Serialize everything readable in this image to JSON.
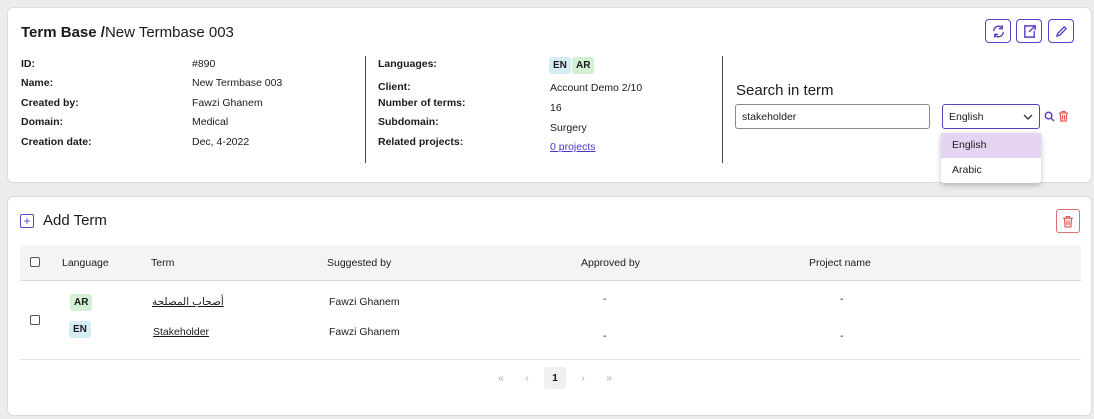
{
  "header": {
    "title_prefix": "Term Base /",
    "title_name": "New Termbase 003"
  },
  "details": {
    "id_label": "ID:",
    "id_value": "#890",
    "name_label": "Name:",
    "name_value": "New Termbase 003",
    "created_by_label": "Created by:",
    "created_by_value": "Fawzi Ghanem",
    "domain_label": "Domain:",
    "domain_value": "Medical",
    "creation_date_label": "Creation date:",
    "creation_date_value": "Dec, 4-2022",
    "languages_label": "Languages:",
    "languages": [
      "EN",
      "AR"
    ],
    "client_label": "Client:",
    "client_value": "Account Demo 2/10",
    "num_terms_label": "Number of terms:",
    "num_terms_value": "16",
    "subdomain_label": "Subdomain:",
    "subdomain_value": "Surgery",
    "related_projects_label": "Related projects:",
    "related_projects_value": "0 projects"
  },
  "search": {
    "title": "Search in term",
    "query": "stakeholder",
    "selected_language": "English",
    "options": [
      "English",
      "Arabic"
    ]
  },
  "add_term": {
    "label": "Add Term"
  },
  "table": {
    "columns": [
      "Language",
      "Term",
      "Suggested by",
      "Approved by",
      "Project name"
    ],
    "entries": [
      {
        "language": "AR",
        "term": "أصحاب المصلحة",
        "suggested_by": "Fawzi Ghanem",
        "approved_by": "-",
        "project_name": "-"
      },
      {
        "language": "EN",
        "term": "Stakeholder",
        "suggested_by": "Fawzi Ghanem",
        "approved_by": "-",
        "project_name": "-"
      }
    ]
  },
  "pagination": {
    "first": "«",
    "prev": "‹",
    "current": "1",
    "next": "›",
    "last": "»"
  },
  "colors": {
    "accent": "#5b3fc4",
    "danger": "#e05a5a",
    "en_badge": "#d6ecf5",
    "ar_badge": "#d3f0d5",
    "dropdown_selected": "#e6d5f2"
  }
}
